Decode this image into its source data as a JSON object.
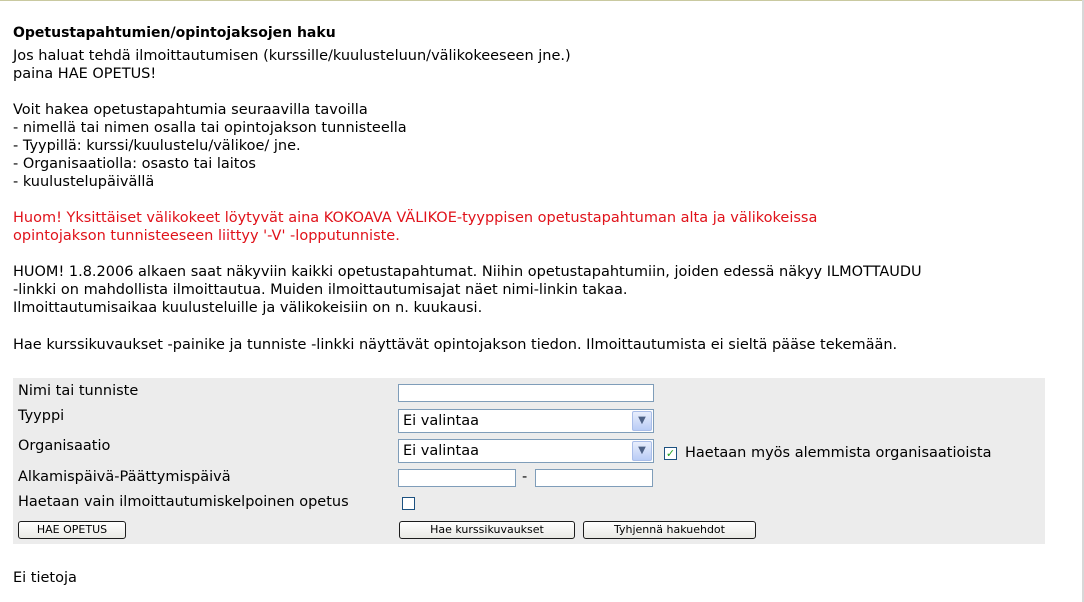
{
  "page": {
    "title": "Opetustapahtumien/opintojaksojen haku",
    "intro_line1": " Jos haluat tehdä ilmoittautumisen (kurssille/kuulusteluun/välikokeeseen jne.)",
    "intro_line2": "paina HAE OPETUS!",
    "search_ways_heading": "Voit hakea opetustapahtumia seuraavilla tavoilla",
    "search_ways": [
      "- nimellä tai nimen osalla tai opintojakson tunnisteella",
      "- Tyypillä: kurssi/kuulustelu/välikoe/ jne.",
      "- Organisaatiolla: osasto tai laitos",
      "- kuulustelupäivällä"
    ],
    "warning_line1": "Huom! Yksittäiset välikokeet löytyvät aina KOKOAVA VÄLIKOE-tyyppisen opetustapahtuman alta ja välikokeissa",
    "warning_line2": "opintojakson tunnisteeseen liittyy '-V' -lopputunniste.",
    "notice_line1": "HUOM! 1.8.2006 alkaen saat näkyviin kaikki opetustapahtumat. Niihin opetustapahtumiin, joiden edessä näkyy ILMOTTAUDU",
    "notice_line2": "-linkki on mahdollista ilmoittautua. Muiden ilmoittautumisajat näet nimi-linkin takaa.",
    "notice_line3": "Ilmoittautumisaikaa kuulusteluille ja välikokeisiin on n. kuukausi.",
    "info_line": "Hae kurssikuvaukset -painike ja tunniste -linkki näyttävät opintojakson tiedon. Ilmoittautumista ei sieltä pääse tekemään.",
    "no_data": "Ei tietoja"
  },
  "form": {
    "name_label": "Nimi tai tunniste",
    "name_value": "",
    "type_label": "Tyyppi",
    "type_selected": "Ei valintaa",
    "org_label": "Organisaatio",
    "org_selected": "Ei valintaa",
    "sub_org_label": "Haetaan myös alemmista organisaatioista",
    "sub_org_checked": true,
    "date_label": "Alkamispäivä-Päättymispäivä",
    "date_separator": "-",
    "start_date": "",
    "end_date": "",
    "only_open_label": "Haetaan vain ilmoittautumiskelpoinen opetus",
    "only_open_checked": false,
    "search_button": "HAE OPETUS",
    "descriptions_button": "Hae kurssikuvaukset",
    "clear_button": "Tyhjennä hakuehdot"
  },
  "icons": {
    "dropdown": "chevron-down-icon",
    "check": "checkmark-icon"
  }
}
